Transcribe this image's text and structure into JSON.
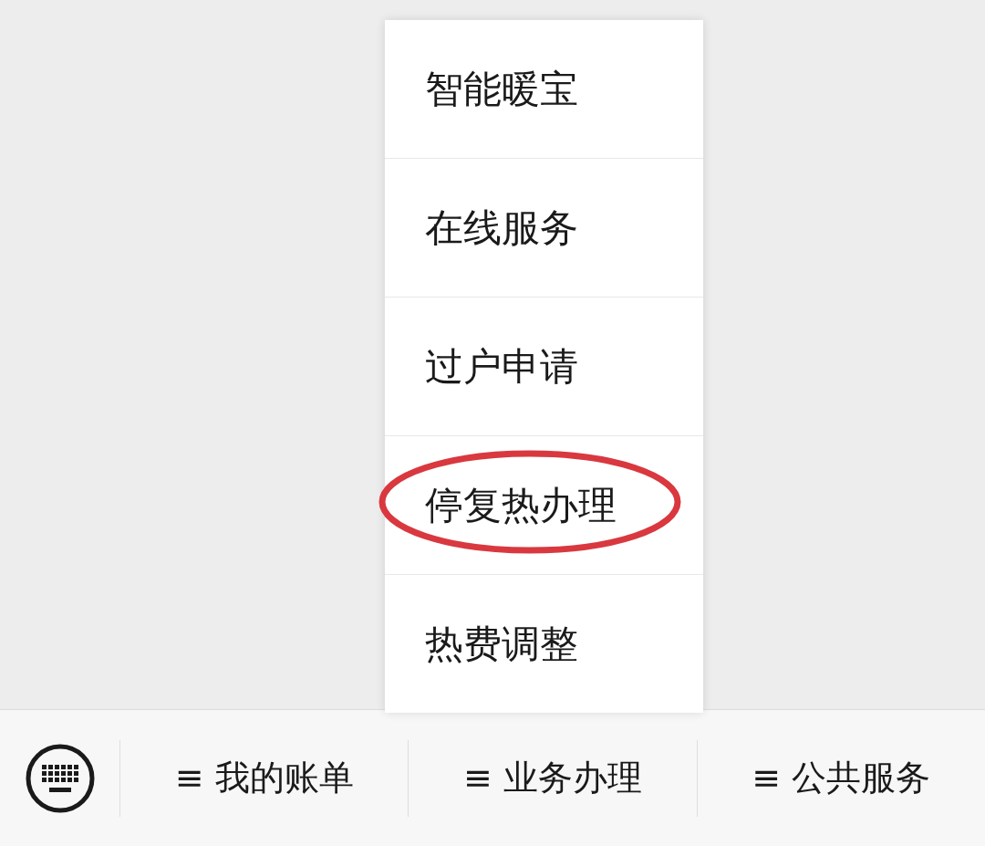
{
  "popup_menu": {
    "items": [
      {
        "label": "智能暖宝",
        "highlighted": false
      },
      {
        "label": "在线服务",
        "highlighted": false
      },
      {
        "label": "过户申请",
        "highlighted": false
      },
      {
        "label": "停复热办理",
        "highlighted": true
      },
      {
        "label": "热费调整",
        "highlighted": false
      }
    ]
  },
  "bottom_bar": {
    "menus": [
      {
        "label": "≡ 我的账单"
      },
      {
        "label": "≡ 业务办理"
      },
      {
        "label": "≡ 公共服务"
      }
    ]
  }
}
